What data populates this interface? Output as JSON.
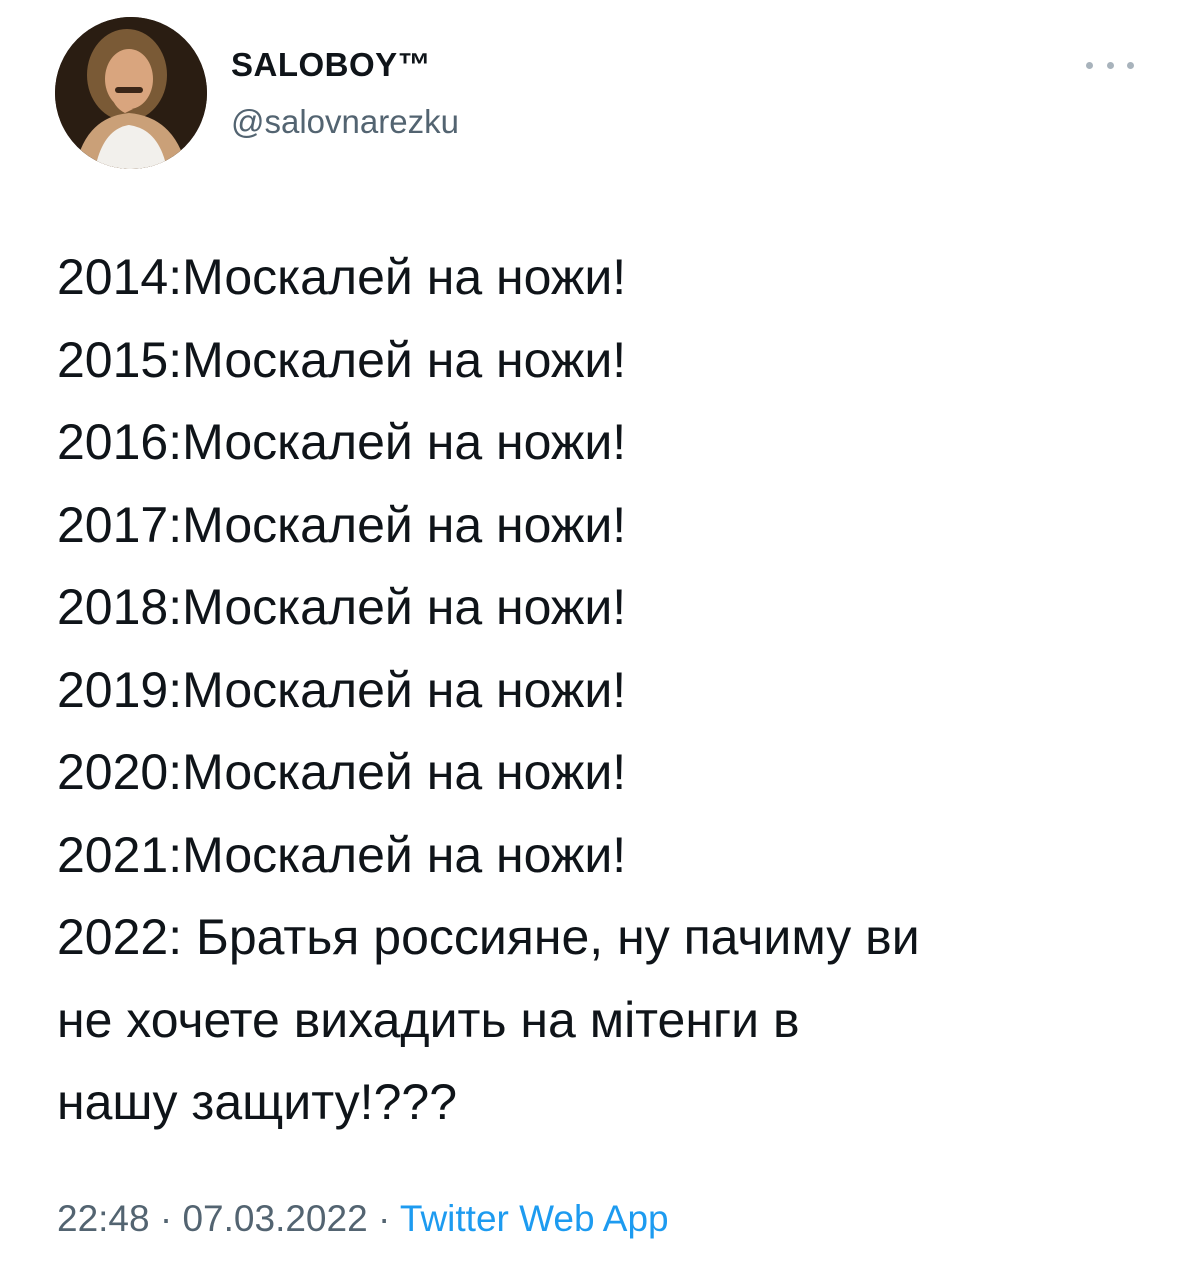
{
  "author": {
    "display_name": "SALOBOY™",
    "username": "@salovnarezku",
    "avatar_icon": "user-avatar-photo"
  },
  "more_icon": "more-horizontal-icon",
  "tweet": {
    "lines": [
      "2014:Москалей на ножи!",
      "2015:Москалей на ножи!",
      "2016:Москалей на ножи!",
      "2017:Москалей на ножи!",
      "2018:Москалей на ножи!",
      "2019:Москалей на ножи!",
      "2020:Москалей на ножи!",
      "2021:Москалей на ножи!",
      "2022: Братья россияне, ну пачиму ви",
      "не хочете вихадить на мітенги в",
      "нашу защиту!???"
    ]
  },
  "meta": {
    "time": "22:48",
    "separator": " · ",
    "date": "07.03.2022",
    "source": "Twitter Web App"
  },
  "colors": {
    "text_primary": "#0f1419",
    "text_secondary": "#536471",
    "link": "#1d9bf0"
  }
}
